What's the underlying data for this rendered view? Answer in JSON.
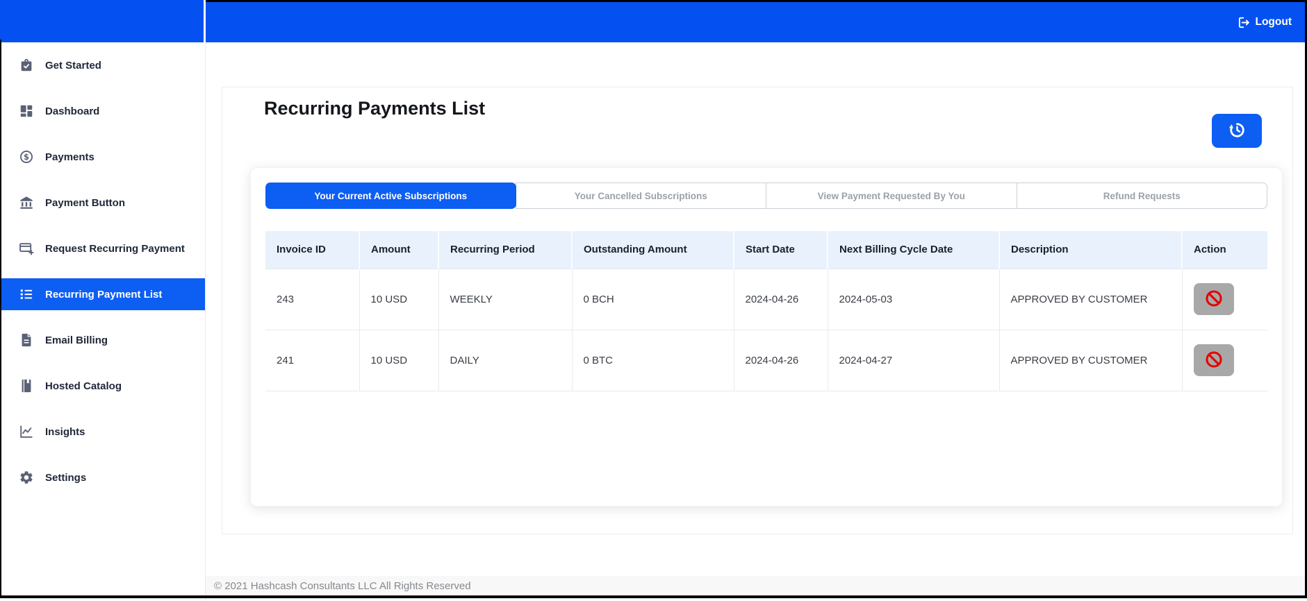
{
  "header": {
    "logout_label": "Logout",
    "logout_icon": "logout-icon"
  },
  "sidebar": {
    "items": [
      {
        "label": "Get Started",
        "icon": "briefcase-check-icon",
        "active": false
      },
      {
        "label": "Dashboard",
        "icon": "grid-icon",
        "active": false
      },
      {
        "label": "Payments",
        "icon": "dollar-circle-icon",
        "active": false
      },
      {
        "label": "Payment Button",
        "icon": "bank-icon",
        "active": false
      },
      {
        "label": "Request Recurring Payment",
        "icon": "card-plus-icon",
        "active": false
      },
      {
        "label": "Recurring Payment List",
        "icon": "list-icon",
        "active": true
      },
      {
        "label": "Email Billing",
        "icon": "file-icon",
        "active": false
      },
      {
        "label": "Hosted Catalog",
        "icon": "book-icon",
        "active": false
      },
      {
        "label": "Insights",
        "icon": "chart-line-icon",
        "active": false
      },
      {
        "label": "Settings",
        "icon": "gear-icon",
        "active": false
      }
    ]
  },
  "main": {
    "title": "Recurring Payments List",
    "refresh_icon": "history-icon",
    "tabs": [
      {
        "label": "Your Current Active Subscriptions",
        "active": true
      },
      {
        "label": "Your Cancelled Subscriptions",
        "active": false
      },
      {
        "label": "View Payment Requested By You",
        "active": false
      },
      {
        "label": "Refund Requests",
        "active": false
      }
    ],
    "table": {
      "columns": [
        "Invoice ID",
        "Amount",
        "Recurring Period",
        "Outstanding Amount",
        "Start Date",
        "Next Billing Cycle Date",
        "Description",
        "Action"
      ],
      "action_icon": "ban-icon",
      "rows": [
        {
          "invoice_id": "243",
          "amount": "10 USD",
          "recurring_period": "WEEKLY",
          "outstanding_amount": "0 BCH",
          "start_date": "2024-04-26",
          "next_billing_cycle_date": "2024-05-03",
          "description": "APPROVED BY CUSTOMER"
        },
        {
          "invoice_id": "241",
          "amount": "10 USD",
          "recurring_period": "DAILY",
          "outstanding_amount": "0 BTC",
          "start_date": "2024-04-26",
          "next_billing_cycle_date": "2024-04-27",
          "description": "APPROVED BY CUSTOMER"
        }
      ]
    }
  },
  "footer": {
    "copyright": "© 2021 Hashcash Consultants LLC All Rights Reserved"
  },
  "colors": {
    "header_blue": "#0450f0",
    "accent_blue": "#0d5ef2",
    "danger_red": "#e60000",
    "table_header_bg": "#e9f1fc"
  }
}
